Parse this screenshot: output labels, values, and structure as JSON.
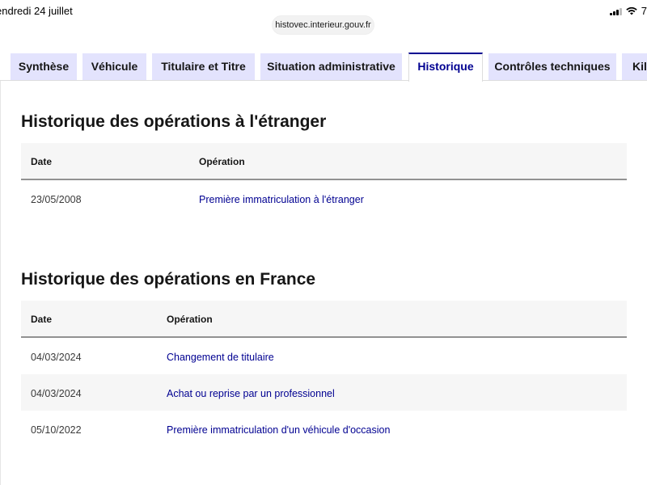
{
  "status_bar": {
    "date": "endredi 24 juillet",
    "battery_fragment": "7",
    "url": "histovec.interieur.gouv.fr"
  },
  "tabs": [
    {
      "label": "Synthèse",
      "active": false
    },
    {
      "label": "Véhicule",
      "active": false
    },
    {
      "label": "Titulaire et Titre",
      "active": false
    },
    {
      "label": "Situation administrative",
      "active": false
    },
    {
      "label": "Historique",
      "active": true
    },
    {
      "label": "Contrôles techniques",
      "active": false
    },
    {
      "label": "Kilo",
      "active": false
    }
  ],
  "sections": {
    "foreign": {
      "title": "Historique des opérations à l'étranger",
      "headers": {
        "date": "Date",
        "operation": "Opération"
      },
      "rows": [
        {
          "date": "23/05/2008",
          "operation": "Première immatriculation à l'étranger"
        }
      ]
    },
    "france": {
      "title": "Historique des opérations en France",
      "headers": {
        "date": "Date",
        "operation": "Opération"
      },
      "rows": [
        {
          "date": "04/03/2024",
          "operation": "Changement de titulaire"
        },
        {
          "date": "04/03/2024",
          "operation": "Achat ou reprise par un professionnel"
        },
        {
          "date": "05/10/2022",
          "operation": "Première immatriculation d'un véhicule d'occasion"
        }
      ]
    }
  },
  "colors": {
    "tab_background": "#e3e3fd",
    "accent": "#000091",
    "table_header_background": "#f6f6f6"
  }
}
